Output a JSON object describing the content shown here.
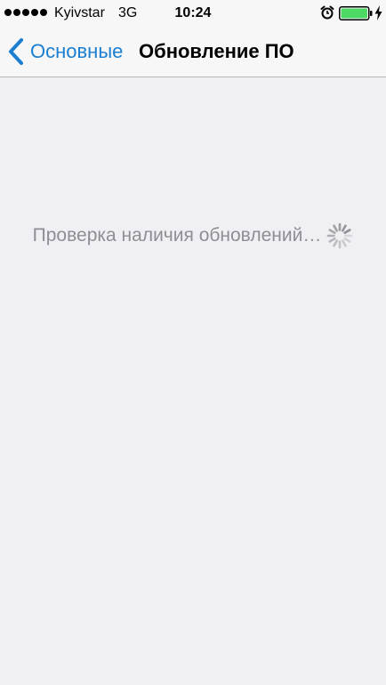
{
  "status_bar": {
    "carrier": "Kyivstar",
    "network": "3G",
    "time": "10:24",
    "signal_bars": 5,
    "battery_level": 1.0,
    "icons": [
      "alarm-icon",
      "battery-icon",
      "charge-icon"
    ]
  },
  "nav": {
    "back_label": "Основные",
    "title": "Обновление ПО"
  },
  "content": {
    "status_text": "Проверка наличия обновлений…",
    "activity_icon": "spinner-icon"
  },
  "colors": {
    "tint": "#1a7ed1",
    "background": "#efeff4",
    "nav_background": "#f7f7f8",
    "status_text": "#8e8e93",
    "battery_fill": "#4cd964"
  }
}
